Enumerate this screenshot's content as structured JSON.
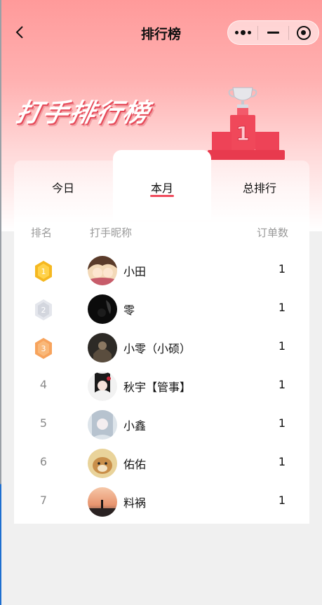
{
  "nav": {
    "title": "排行榜"
  },
  "hero": {
    "title": "打手排行榜"
  },
  "tabs": [
    {
      "label": "今日",
      "active": false
    },
    {
      "label": "本月",
      "active": true
    },
    {
      "label": "总排行",
      "active": false
    }
  ],
  "table": {
    "headers": {
      "rank": "排名",
      "name": "打手昵称",
      "orders": "订单数"
    },
    "rows": [
      {
        "rank": "1",
        "name": "小田",
        "orders": "1",
        "badge": "gold"
      },
      {
        "rank": "2",
        "name": "零",
        "orders": "1",
        "badge": "silver"
      },
      {
        "rank": "3",
        "name": "小零（小硕）",
        "orders": "1",
        "badge": "bronze"
      },
      {
        "rank": "4",
        "name": "秋宇【管事】",
        "orders": "1"
      },
      {
        "rank": "5",
        "name": "小鑫",
        "orders": "1"
      },
      {
        "rank": "6",
        "name": "佑佑",
        "orders": "1"
      },
      {
        "rank": "7",
        "name": "料祸",
        "orders": "1"
      }
    ]
  },
  "colors": {
    "accent": "#f04b5c",
    "gold": "#f5b820",
    "silver": "#d8dbe3",
    "bronze": "#f7a35c"
  },
  "icons": {
    "back": "chevron-left-icon",
    "more": "more-dots-icon",
    "minimize": "minus-icon",
    "close": "target-circle-icon",
    "trophy": "trophy-podium-icon"
  }
}
